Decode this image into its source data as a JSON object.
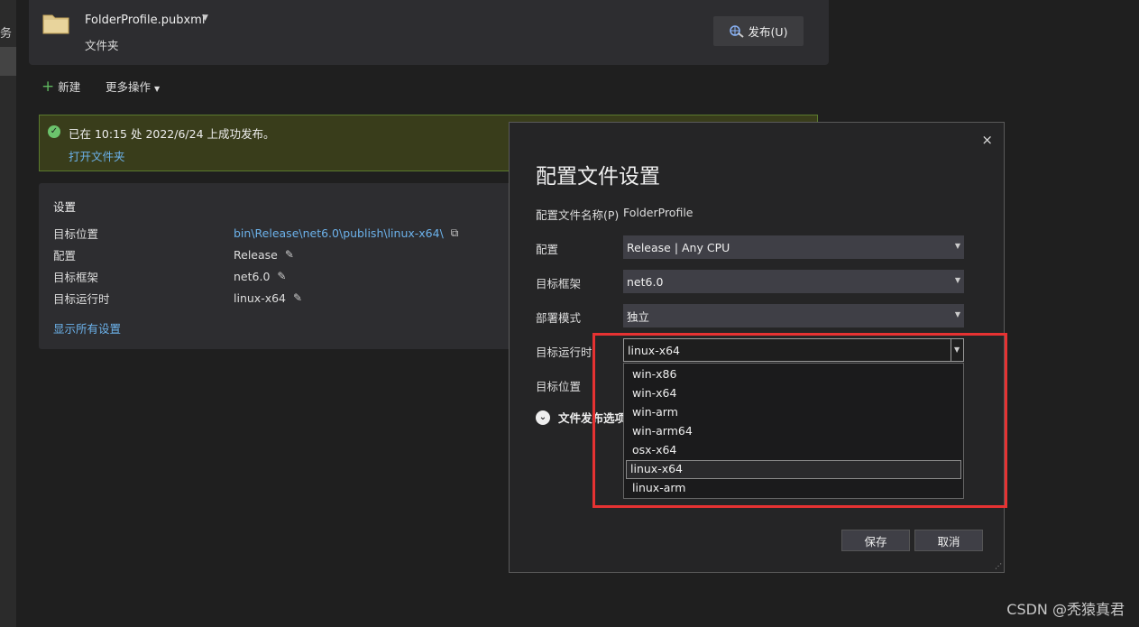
{
  "left_rail": {
    "char": "务"
  },
  "profile": {
    "name": "FolderProfile.pubxml",
    "type": "文件夹",
    "publish_label": "发布(U)"
  },
  "toolbar": {
    "new_label": "新建",
    "more_label": "更多操作"
  },
  "banner": {
    "message": "已在 10:15 处 2022/6/24 上成功发布。",
    "link": "打开文件夹"
  },
  "settings": {
    "title": "设置",
    "rows": [
      {
        "label": "目标位置",
        "value": "bin\\Release\\net6.0\\publish\\linux-x64\\"
      },
      {
        "label": "配置",
        "value": "Release"
      },
      {
        "label": "目标框架",
        "value": "net6.0"
      },
      {
        "label": "目标运行时",
        "value": "linux-x64"
      }
    ],
    "show_all": "显示所有设置"
  },
  "dialog": {
    "title": "配置文件设置",
    "close": "×",
    "profile_name_label": "配置文件名称(P)",
    "profile_name_value": "FolderProfile",
    "config_label": "配置",
    "config_value": "Release | Any CPU",
    "framework_label": "目标框架",
    "framework_value": "net6.0",
    "deploy_label": "部署模式",
    "deploy_value": "独立",
    "runtime_label": "目标运行时",
    "runtime_value": "linux-x64",
    "location_label": "目标位置",
    "expander_label": "文件发布选项",
    "runtime_options": [
      "win-x86",
      "win-x64",
      "win-arm",
      "win-arm64",
      "osx-x64",
      "linux-x64",
      "linux-arm"
    ],
    "runtime_selected": "linux-x64",
    "save_label": "保存",
    "cancel_label": "取消"
  },
  "watermark": "CSDN @秃猿真君",
  "colors": {
    "link": "#6cb2eb",
    "success_bg": "#393d1b",
    "highlight": "#e63232"
  }
}
